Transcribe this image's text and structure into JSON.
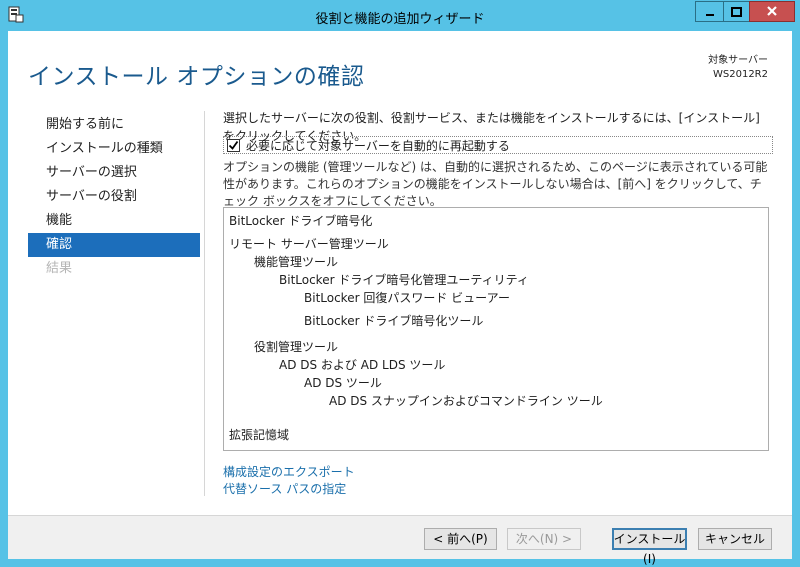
{
  "window": {
    "title": "役割と機能の追加ウィザード",
    "accent": "#56c2e6"
  },
  "header": {
    "title": "インストール オプションの確認",
    "server_label": "対象サーバー",
    "server_name": "WS2012R2"
  },
  "nav": {
    "items": [
      {
        "label": "開始する前に",
        "state": "normal"
      },
      {
        "label": "インストールの種類",
        "state": "normal"
      },
      {
        "label": "サーバーの選択",
        "state": "normal"
      },
      {
        "label": "サーバーの役割",
        "state": "normal"
      },
      {
        "label": "機能",
        "state": "normal"
      },
      {
        "label": "確認",
        "state": "active"
      },
      {
        "label": "結果",
        "state": "disabled"
      }
    ]
  },
  "main": {
    "intro": "選択したサーバーに次の役割、役割サービス、または機能をインストールするには、[インストール] をクリックしてください。",
    "restart_label": "必要に応じて対象サーバーを自動的に再起動する",
    "restart_checked": true,
    "note": "オプションの機能 (管理ツールなど) は、自動的に選択されるため、このページに表示されている可能性があります。これらのオプションの機能をインストールしない場合は、[前へ] をクリックして、チェック ボックスをオフにしてください。",
    "items": [
      "BitLocker ドライブ暗号化",
      "リモート サーバー管理ツール",
      "機能管理ツール",
      "BitLocker ドライブ暗号化管理ユーティリティ",
      "BitLocker 回復パスワード ビューアー",
      "BitLocker ドライブ暗号化ツール",
      "役割管理ツール",
      "AD DS および AD LDS ツール",
      "AD DS ツール",
      "AD DS スナップインおよびコマンドライン ツール",
      "拡張記憶域"
    ],
    "links": {
      "export": "構成設定のエクスポート",
      "alt_source": "代替ソース パスの指定"
    }
  },
  "footer": {
    "prev": "< 前へ(P)",
    "next": "次へ(N) >",
    "install": "インストール(I)",
    "cancel": "キャンセル"
  }
}
